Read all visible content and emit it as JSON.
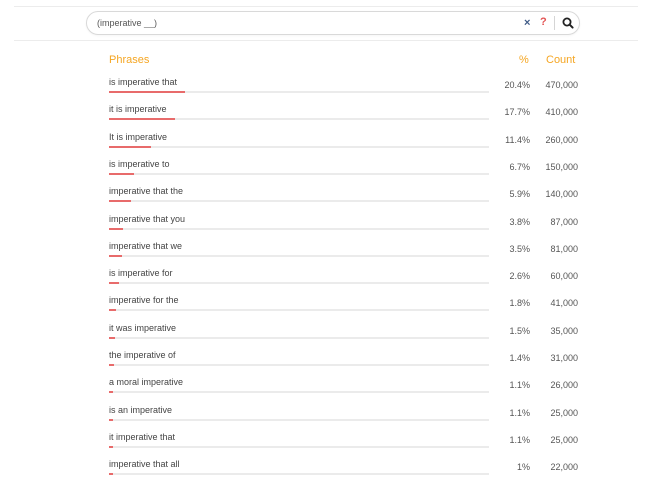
{
  "search": {
    "value": "(imperative __)",
    "clear_icon": "×",
    "help_icon": "?"
  },
  "table": {
    "headers": {
      "phrases": "Phrases",
      "percent": "%",
      "count": "Count"
    },
    "rows": [
      {
        "phrase": "is imperative that",
        "percent": "20.4%",
        "count": "470,000",
        "fraction": 0.204
      },
      {
        "phrase": "it is imperative",
        "percent": "17.7%",
        "count": "410,000",
        "fraction": 0.177
      },
      {
        "phrase": "It is imperative",
        "percent": "11.4%",
        "count": "260,000",
        "fraction": 0.114
      },
      {
        "phrase": "is imperative to",
        "percent": "6.7%",
        "count": "150,000",
        "fraction": 0.067
      },
      {
        "phrase": "imperative that the",
        "percent": "5.9%",
        "count": "140,000",
        "fraction": 0.059
      },
      {
        "phrase": "imperative that you",
        "percent": "3.8%",
        "count": "87,000",
        "fraction": 0.038
      },
      {
        "phrase": "imperative that we",
        "percent": "3.5%",
        "count": "81,000",
        "fraction": 0.035
      },
      {
        "phrase": "is imperative for",
        "percent": "2.6%",
        "count": "60,000",
        "fraction": 0.026
      },
      {
        "phrase": "imperative for the",
        "percent": "1.8%",
        "count": "41,000",
        "fraction": 0.018
      },
      {
        "phrase": "it was imperative",
        "percent": "1.5%",
        "count": "35,000",
        "fraction": 0.015
      },
      {
        "phrase": "the imperative of",
        "percent": "1.4%",
        "count": "31,000",
        "fraction": 0.014
      },
      {
        "phrase": "a moral imperative",
        "percent": "1.1%",
        "count": "26,000",
        "fraction": 0.011
      },
      {
        "phrase": "is an imperative",
        "percent": "1.1%",
        "count": "25,000",
        "fraction": 0.011
      },
      {
        "phrase": "it imperative that",
        "percent": "1.1%",
        "count": "25,000",
        "fraction": 0.011
      },
      {
        "phrase": "imperative that all",
        "percent": "1%",
        "count": "22,000",
        "fraction": 0.01
      }
    ]
  },
  "colors": {
    "accent": "#f5a623",
    "bar": "#e86b6b",
    "help": "#e35353",
    "clear": "#3f5b87"
  }
}
